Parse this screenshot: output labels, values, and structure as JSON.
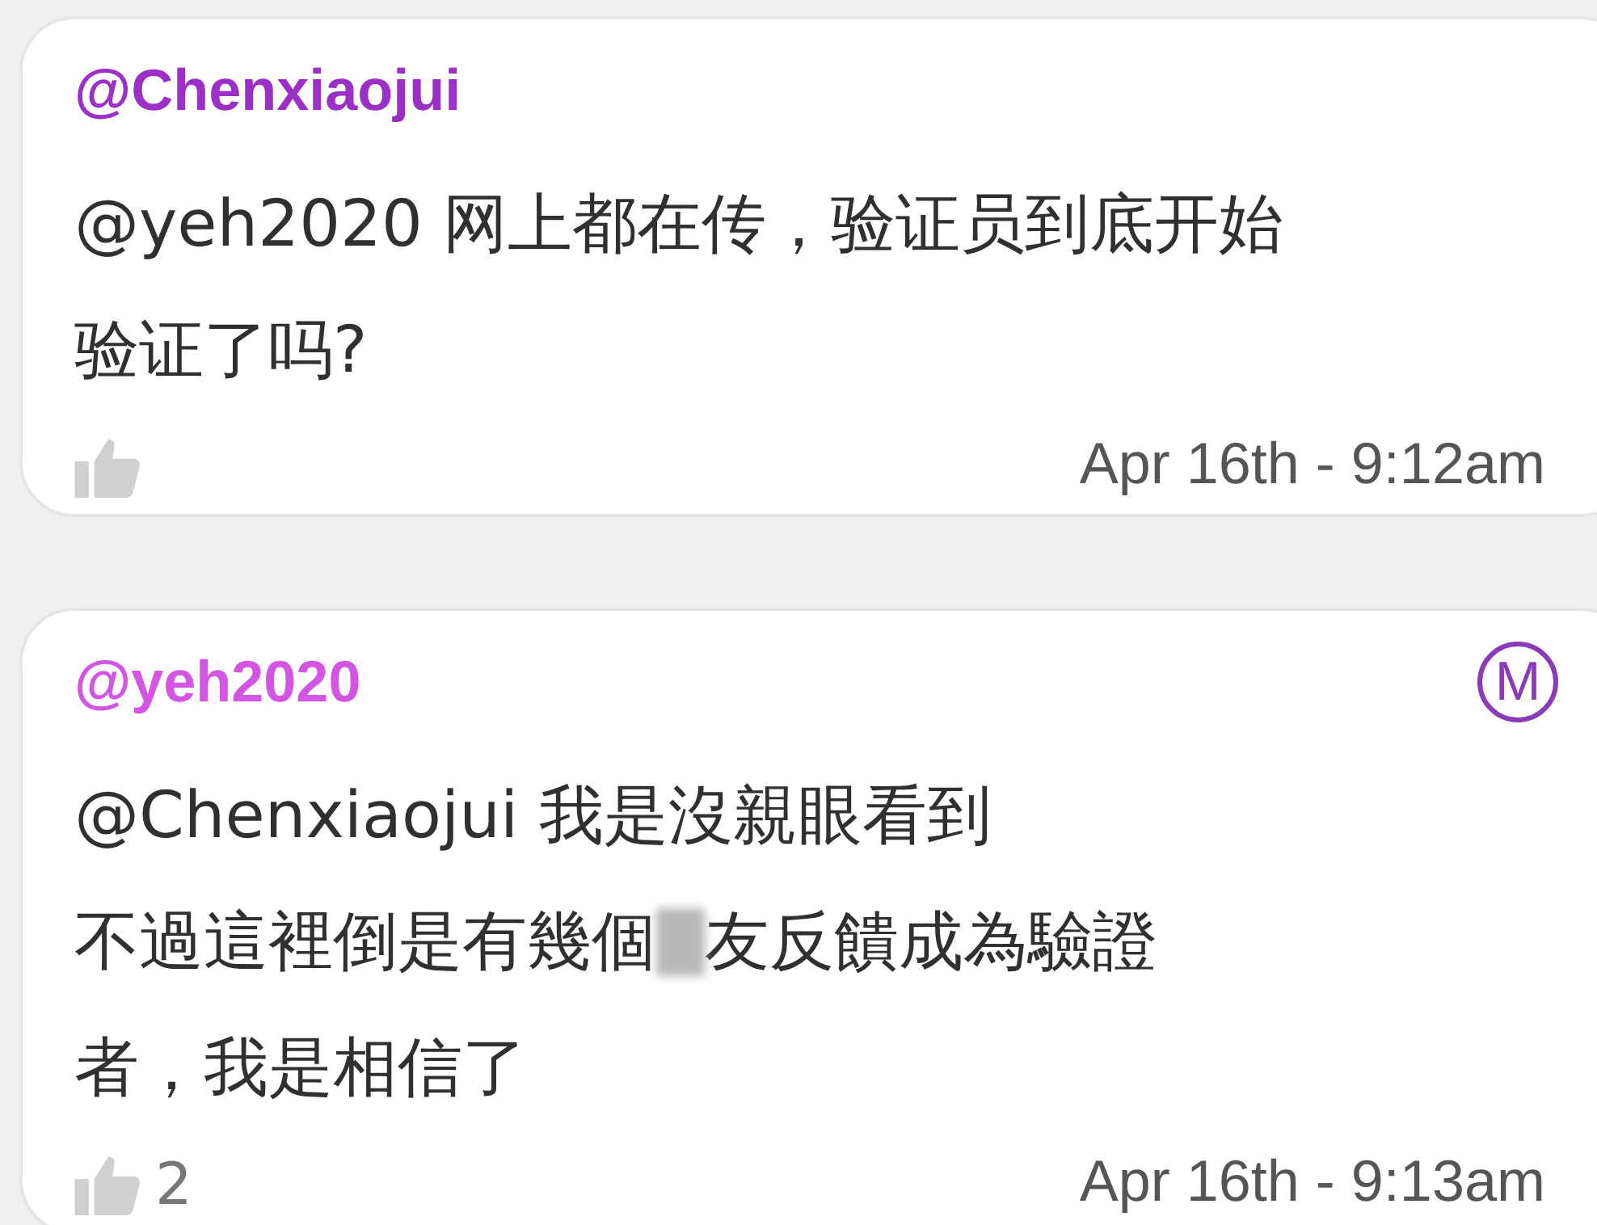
{
  "comments": [
    {
      "author": "@Chenxiaojui",
      "color": "#9c2fc6",
      "lines": [
        [
          {
            "kind": "text",
            "text": "@yeh2020 网上都在传，验证员到底开始"
          }
        ],
        [
          {
            "kind": "text",
            "text": "验证了吗?"
          }
        ]
      ],
      "time": "Apr 16th - 9:12am"
    },
    {
      "author": "@yeh2020",
      "color": "#d455e4",
      "badge": "M",
      "lines": [
        [
          {
            "kind": "text",
            "text": "@Chenxiaojui 我是沒親眼看到"
          }
        ],
        [
          {
            "kind": "text",
            "text": "不過這裡倒是有幾個"
          },
          {
            "kind": "censored"
          },
          {
            "kind": "text",
            "text": "友反饋成為驗證"
          }
        ],
        [
          {
            "kind": "text",
            "text": "者，我是相信了"
          }
        ]
      ],
      "likes": "2",
      "time": "Apr 16th - 9:13am"
    }
  ]
}
